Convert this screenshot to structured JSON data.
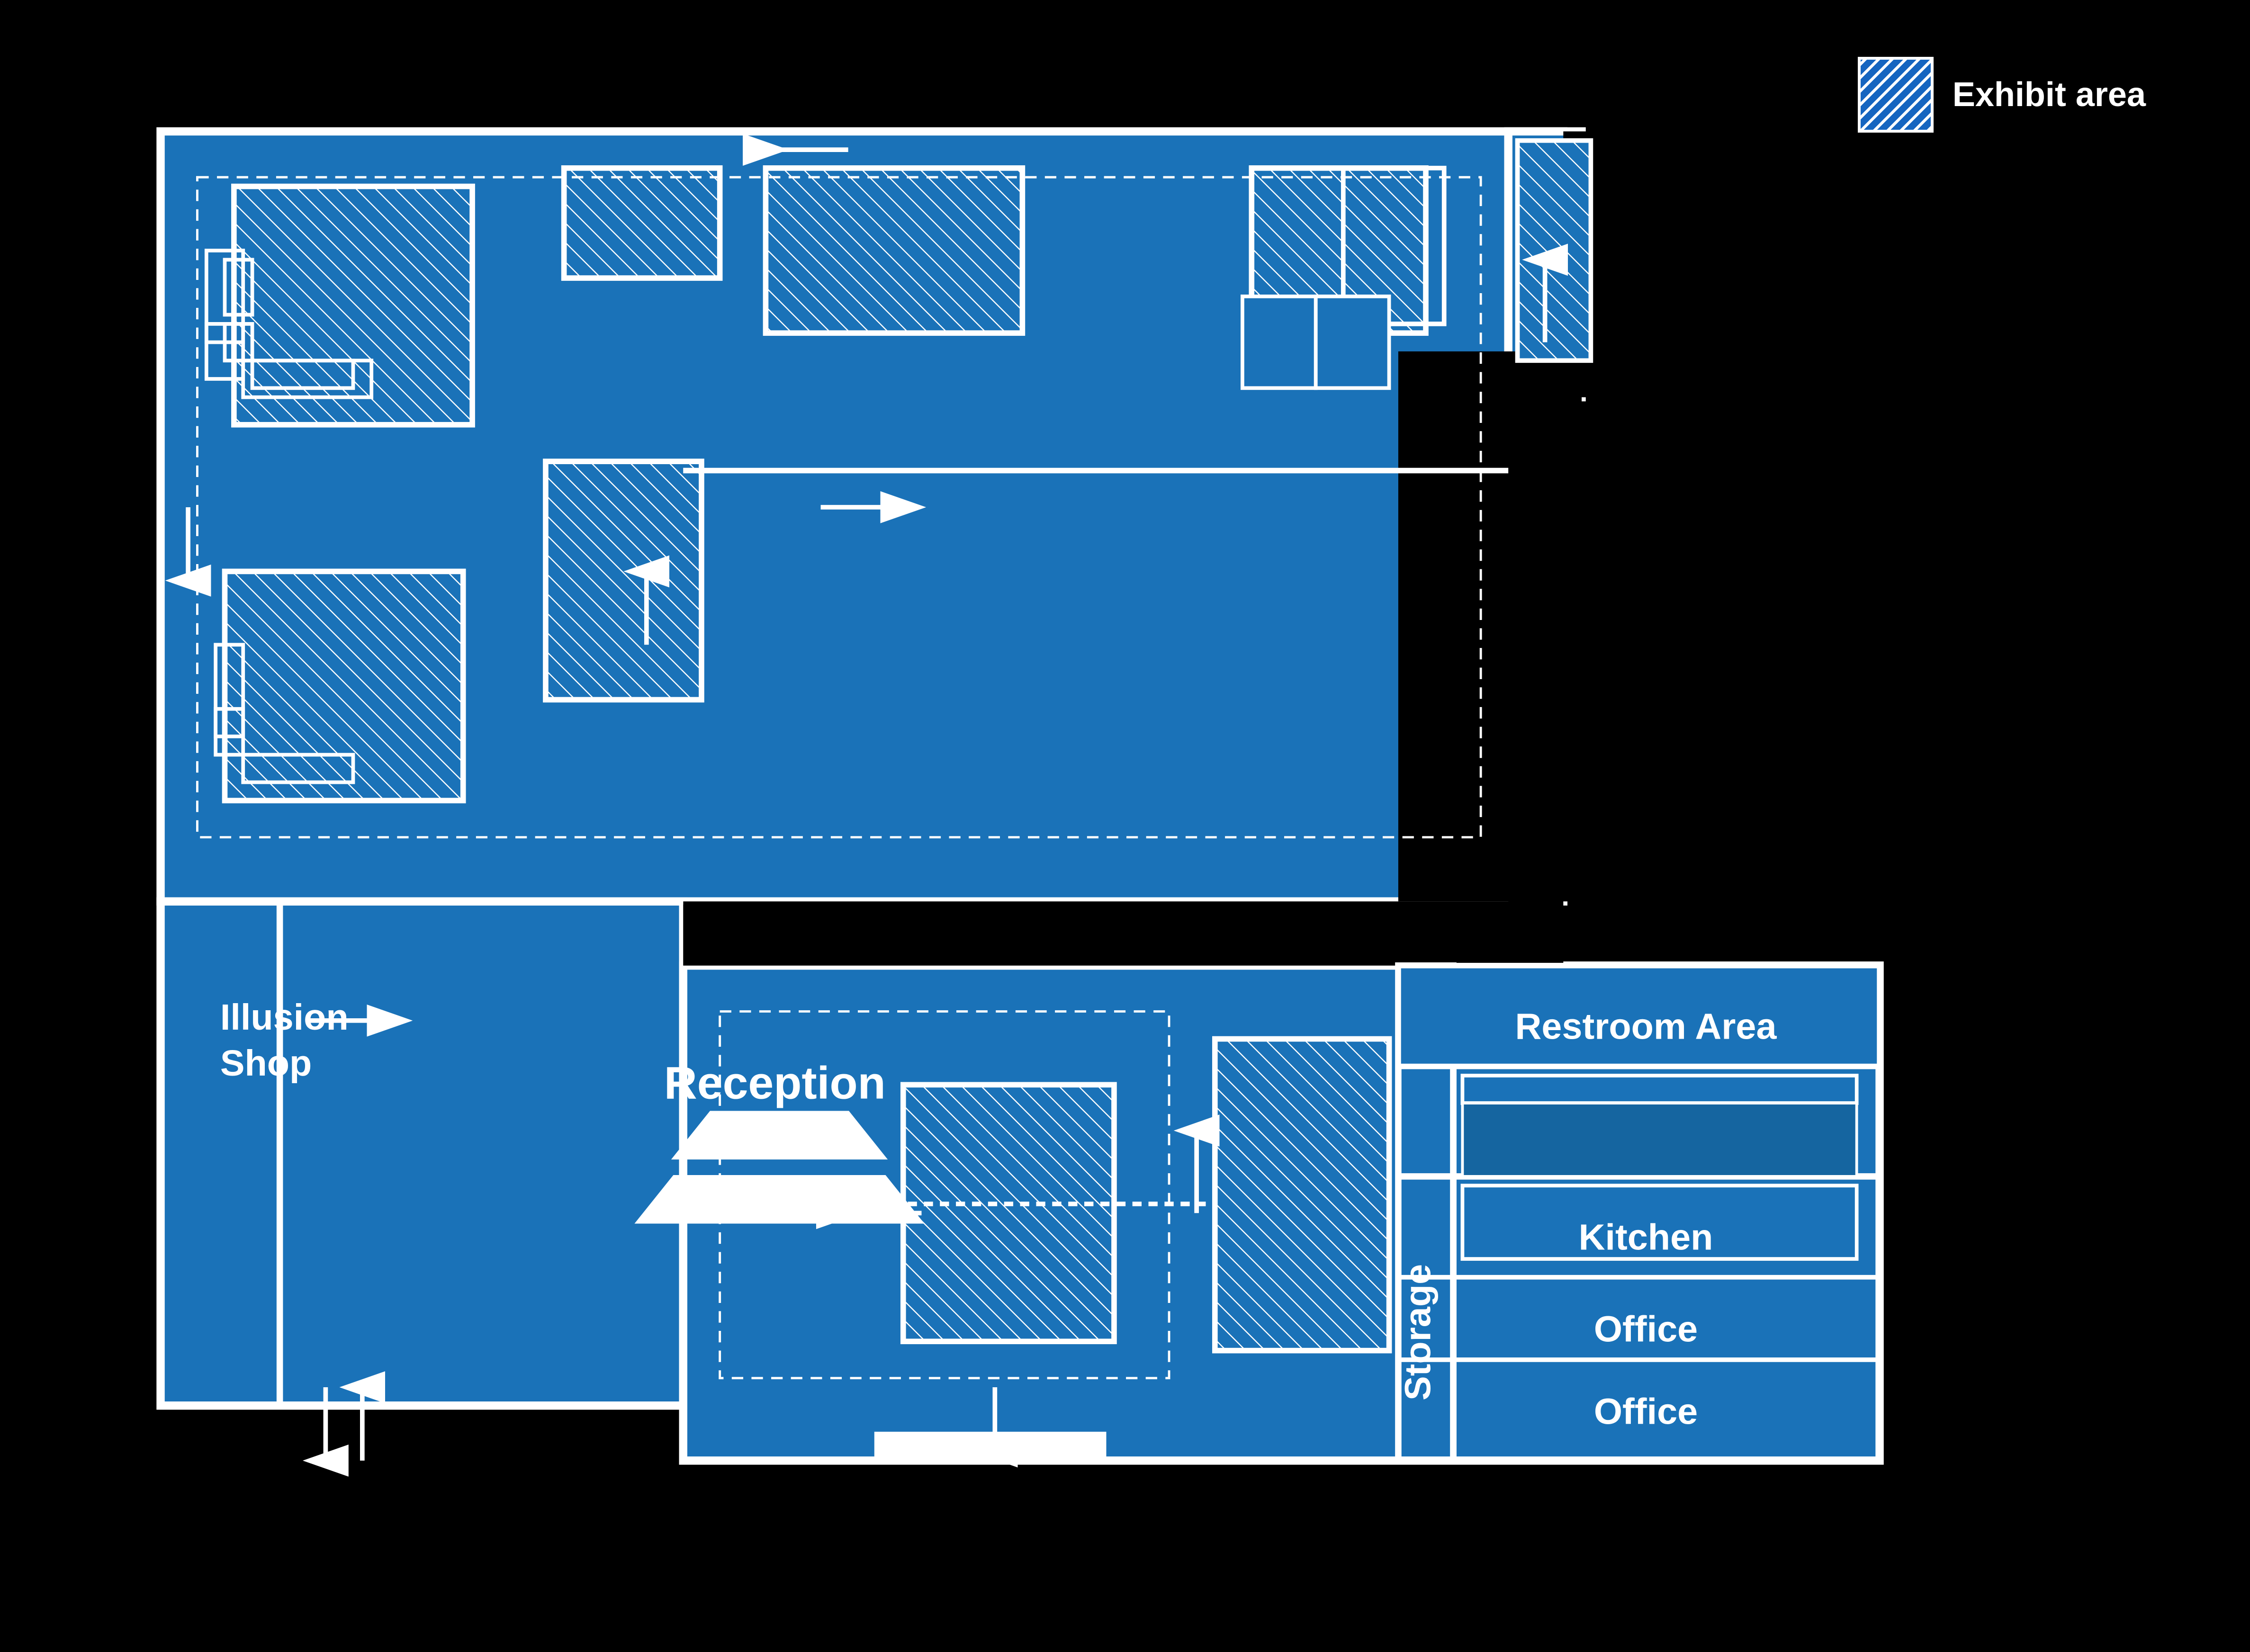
{
  "legend": {
    "label": "Exhibit area"
  },
  "rooms": {
    "reception": "Reception",
    "illusion_shop": "Illusion\nShop",
    "restroom_area": "Restroom Area",
    "storage": "Storage",
    "kitchen": "Kitchen",
    "office1": "Office",
    "office2": "Office"
  },
  "colors": {
    "floor": "#1a72b8",
    "wall": "white",
    "background": "#000000",
    "hatch": "white"
  }
}
